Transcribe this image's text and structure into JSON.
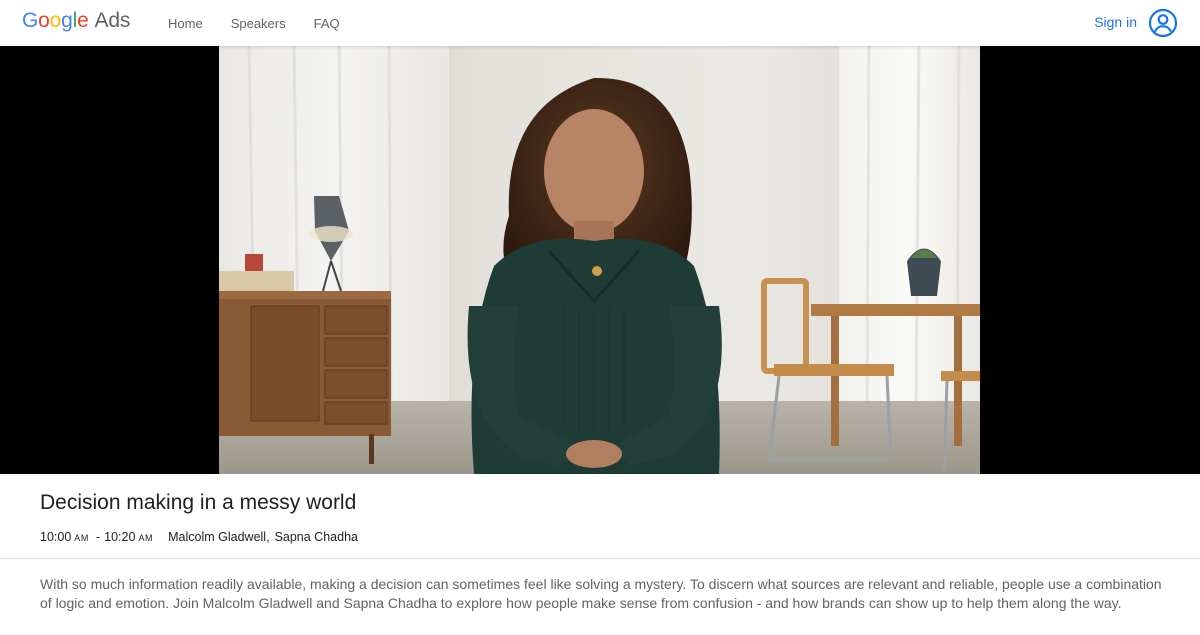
{
  "header": {
    "logo_word": "Google",
    "logo_product": "Ads",
    "nav": [
      {
        "label": "Home"
      },
      {
        "label": "Speakers"
      },
      {
        "label": "FAQ"
      }
    ],
    "signin_label": "Sign in",
    "account_icon": "account-circle-icon",
    "colors": {
      "blue": "#4285F4",
      "red": "#EA4335",
      "yellow": "#FBBC05",
      "green": "#34A853",
      "link": "#1a73e8"
    }
  },
  "session": {
    "title": "Decision making in a messy world",
    "start_time": "10:00",
    "start_period": "AM",
    "end_time": "10:20",
    "end_period": "AM",
    "speakers": [
      "Malcolm Gladwell,",
      "Sapna Chadha"
    ],
    "description": "With so much information readily available, making a decision can sometimes feel like solving a mystery. To discern what sources are relevant and reliable, people use a combination of logic and emotion. Join Malcolm Gladwell and Sapna Chadha to explore how people make sense from confusion - and how brands can show up to help them along the way."
  }
}
